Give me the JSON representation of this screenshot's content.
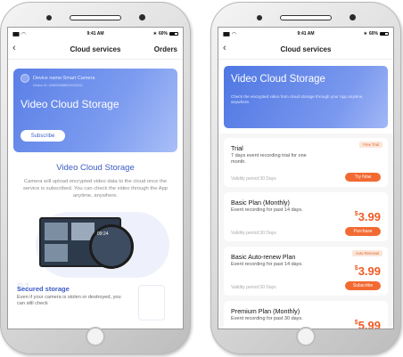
{
  "status": {
    "time": "9:41 AM",
    "battery": "60%"
  },
  "left": {
    "nav": {
      "title": "Cloud services",
      "orders": "Orders"
    },
    "banner": {
      "device_name": "Device name:Smart Camera",
      "device_id": "Device ID: 4285933885910024032",
      "title": "Video Cloud Storage",
      "subscribe_label": "Subscribe"
    },
    "section_title": "Video Cloud Storage",
    "section_desc": "Camera will upload encrypted video data to the cloud once the service is subscribed. You can check the video through the App anytime, anywhere.",
    "illustration_time": "09:24",
    "feature": {
      "number": "01",
      "title": "Secured storage",
      "desc": "Even if your camera is stolen or destroyed, you can still check"
    }
  },
  "right": {
    "nav": {
      "title": "Cloud services"
    },
    "banner": {
      "title": "Video Cloud Storage",
      "desc": "Check the encrypted video from cloud storage through your App anytime, anywhere."
    },
    "plans": [
      {
        "name": "Trial",
        "desc": "7 days event recording trial for one month.",
        "validity": "Validity period:30 Days",
        "tag": "Free Trial",
        "price": "",
        "button": "Try Now"
      },
      {
        "name": "Basic Plan (Monthly)",
        "desc": "Event recording for past 14 days.",
        "validity": "Validity period:30 Days",
        "tag": "",
        "currency": "$",
        "price": "3.99",
        "button": "Purchase"
      },
      {
        "name": "Basic Auto-renew Plan",
        "desc": "Event recording for past 14 days.",
        "validity": "Validity period:30 Days",
        "tag": "Auto-Renewal",
        "currency": "$",
        "price": "3.99",
        "button": "Subscribe"
      },
      {
        "name": "Premium Plan (Monthly)",
        "desc": "Event recording for past 30 days.",
        "currency": "$",
        "price": "5.99"
      }
    ]
  }
}
